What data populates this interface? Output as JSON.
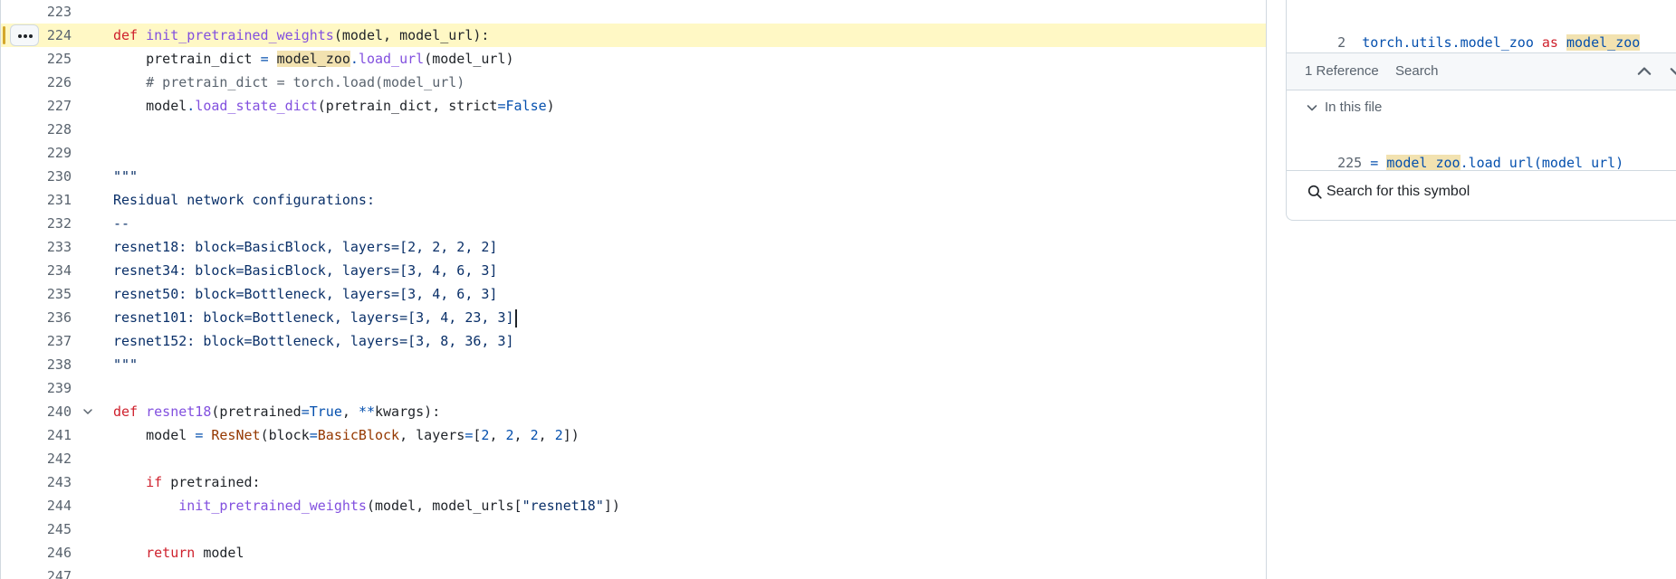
{
  "editor": {
    "lines": [
      {
        "n": "223",
        "tokens": []
      },
      {
        "n": "224",
        "highlight": true,
        "tokens": [
          {
            "t": "def",
            "c": "kw"
          },
          {
            "t": " "
          },
          {
            "t": "init_pretrained_weights",
            "c": "fn"
          },
          {
            "t": "(model, model_url):"
          }
        ]
      },
      {
        "n": "225",
        "tokens": [
          {
            "t": "    pretrain_dict "
          },
          {
            "t": "=",
            "c": "const"
          },
          {
            "t": " "
          },
          {
            "t": "model_zoo",
            "c": "mark"
          },
          {
            "t": ".",
            "c": "const"
          },
          {
            "t": "load_url",
            "c": "fn"
          },
          {
            "t": "(model_url)"
          }
        ]
      },
      {
        "n": "226",
        "tokens": [
          {
            "t": "    # pretrain_dict = torch.load(model_url)",
            "c": "cmt"
          }
        ]
      },
      {
        "n": "227",
        "tokens": [
          {
            "t": "    model"
          },
          {
            "t": ".",
            "c": "const"
          },
          {
            "t": "load_state_dict",
            "c": "fn"
          },
          {
            "t": "(pretrain_dict, strict"
          },
          {
            "t": "=",
            "c": "const"
          },
          {
            "t": "False",
            "c": "const"
          },
          {
            "t": ")"
          }
        ]
      },
      {
        "n": "228",
        "tokens": []
      },
      {
        "n": "229",
        "tokens": []
      },
      {
        "n": "230",
        "tokens": [
          {
            "t": "\"\"\"",
            "c": "str"
          }
        ]
      },
      {
        "n": "231",
        "tokens": [
          {
            "t": "Residual network configurations:",
            "c": "str"
          }
        ]
      },
      {
        "n": "232",
        "tokens": [
          {
            "t": "--",
            "c": "str"
          }
        ]
      },
      {
        "n": "233",
        "tokens": [
          {
            "t": "resnet18: block=BasicBlock, layers=[2, 2, 2, 2]",
            "c": "str"
          }
        ]
      },
      {
        "n": "234",
        "tokens": [
          {
            "t": "resnet34: block=BasicBlock, layers=[3, 4, 6, 3]",
            "c": "str"
          }
        ]
      },
      {
        "n": "235",
        "tokens": [
          {
            "t": "resnet50: block=Bottleneck, layers=[3, 4, 6, 3]",
            "c": "str"
          }
        ]
      },
      {
        "n": "236",
        "caret": true,
        "tokens": [
          {
            "t": "resnet101: block=Bottleneck, layers=[3, 4, 23, 3]",
            "c": "str"
          }
        ]
      },
      {
        "n": "237",
        "tokens": [
          {
            "t": "resnet152: block=Bottleneck, layers=[3, 8, 36, 3]",
            "c": "str"
          }
        ]
      },
      {
        "n": "238",
        "tokens": [
          {
            "t": "\"\"\"",
            "c": "str"
          }
        ]
      },
      {
        "n": "239",
        "tokens": []
      },
      {
        "n": "240",
        "fold": true,
        "tokens": [
          {
            "t": "def",
            "c": "kw"
          },
          {
            "t": " "
          },
          {
            "t": "resnet18",
            "c": "fn"
          },
          {
            "t": "(pretrained"
          },
          {
            "t": "=",
            "c": "const"
          },
          {
            "t": "True",
            "c": "const"
          },
          {
            "t": ", "
          },
          {
            "t": "**",
            "c": "const"
          },
          {
            "t": "kwargs):"
          }
        ]
      },
      {
        "n": "241",
        "tokens": [
          {
            "t": "    model "
          },
          {
            "t": "=",
            "c": "const"
          },
          {
            "t": " "
          },
          {
            "t": "ResNet",
            "c": "cls"
          },
          {
            "t": "(block"
          },
          {
            "t": "=",
            "c": "const"
          },
          {
            "t": "BasicBlock",
            "c": "cls"
          },
          {
            "t": ", layers"
          },
          {
            "t": "=",
            "c": "const"
          },
          {
            "t": "["
          },
          {
            "t": "2",
            "c": "const"
          },
          {
            "t": ", "
          },
          {
            "t": "2",
            "c": "const"
          },
          {
            "t": ", "
          },
          {
            "t": "2",
            "c": "const"
          },
          {
            "t": ", "
          },
          {
            "t": "2",
            "c": "const"
          },
          {
            "t": "])"
          }
        ]
      },
      {
        "n": "242",
        "tokens": []
      },
      {
        "n": "243",
        "tokens": [
          {
            "t": "    "
          },
          {
            "t": "if",
            "c": "kw"
          },
          {
            "t": " pretrained:"
          }
        ]
      },
      {
        "n": "244",
        "tokens": [
          {
            "t": "        "
          },
          {
            "t": "init_pretrained_weights",
            "c": "fn"
          },
          {
            "t": "(model, model_urls["
          },
          {
            "t": "\"resnet18\"",
            "c": "str"
          },
          {
            "t": "])"
          }
        ]
      },
      {
        "n": "245",
        "tokens": []
      },
      {
        "n": "246",
        "tokens": [
          {
            "t": "    "
          },
          {
            "t": "return",
            "c": "kw"
          },
          {
            "t": " model"
          }
        ]
      },
      {
        "n": "247",
        "tokens": []
      }
    ]
  },
  "symbol_panel": {
    "definition": {
      "line_number": "2",
      "tokens": [
        {
          "t": "torch.utils.model_zoo",
          "c": "const"
        },
        {
          "t": " "
        },
        {
          "t": "as",
          "c": "kw"
        },
        {
          "t": " "
        },
        {
          "t": "model_zoo",
          "c": "mark-const"
        }
      ]
    },
    "references_label": "1 Reference",
    "search_tab": "Search",
    "in_this_file": "In this file",
    "reference": {
      "line_number": "225",
      "tokens": [
        {
          "t": "= ",
          "c": "const"
        },
        {
          "t": "model_zoo",
          "c": "mark-const"
        },
        {
          "t": ".load_url(model_url)",
          "c": "const"
        }
      ]
    },
    "search_symbol": "Search for this symbol"
  }
}
